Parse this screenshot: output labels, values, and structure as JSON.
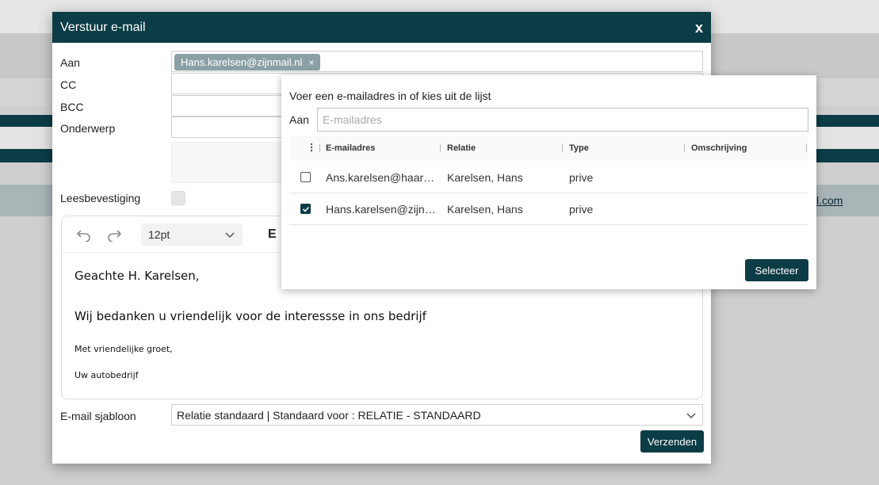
{
  "background": {
    "link_text": "l.com"
  },
  "dialog": {
    "title": "Verstuur e-mail",
    "close_label": "x",
    "labels": {
      "to": "Aan",
      "cc": "CC",
      "bcc": "BCC",
      "subject": "Onderwerp",
      "read_receipt": "Leesbevestiging",
      "template": "E-mail sjabloon"
    },
    "to_chip": "Hans.karelsen@zijnmail.nl",
    "chip_remove": "×",
    "toolbar": {
      "font_size": "12pt",
      "partial_label": "E"
    },
    "body": {
      "greeting": "Geachte H. Karelsen,",
      "line1": "Wij bedanken u vriendelijk voor de interessse in ons bedrijf",
      "closing": "Met vriendelijke groet,",
      "signature": "Uw autobedrijf"
    },
    "template_value": "Relatie standaard | Standaard voor : RELATIE - STANDAARD",
    "send_label": "Verzenden"
  },
  "popup": {
    "title": "Voer een e-mailadres in of kies uit de lijst",
    "to_label": "Aan",
    "input_placeholder": "E-mailadres",
    "columns": [
      "E-mailadres",
      "Relatie",
      "Type",
      "Omschrijving"
    ],
    "rows": [
      {
        "checked": false,
        "email": "Ans.karelsen@haarmail.nl",
        "relation": "Karelsen, Hans",
        "type": "prive",
        "description": ""
      },
      {
        "checked": true,
        "email": "Hans.karelsen@zijnmail.nl",
        "relation": "Karelsen, Hans",
        "type": "prive",
        "description": ""
      }
    ],
    "select_label": "Selecteer"
  },
  "colors": {
    "brand": "#0c3c45",
    "chip": "#8aa0a5"
  }
}
